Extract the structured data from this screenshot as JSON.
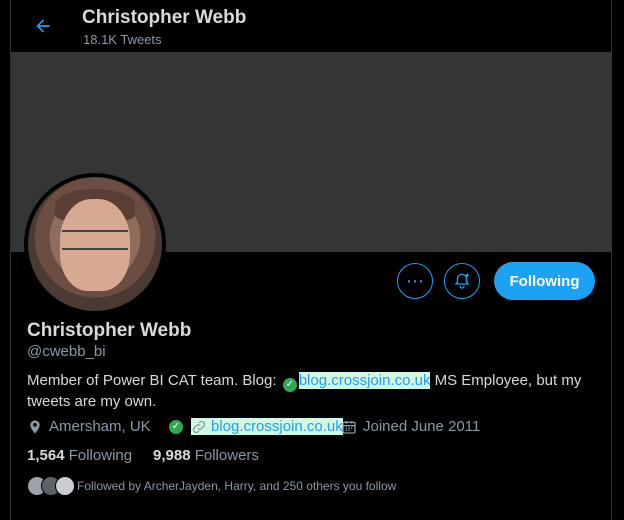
{
  "header": {
    "title": "Christopher Webb",
    "tweets_count": "18.1K Tweets"
  },
  "profile": {
    "name": "Christopher Webb",
    "handle": "@cwebb_bi",
    "bio_prefix": "Member of Power BI CAT team. Blog: ",
    "bio_link": "blog.crossjoin.co.uk",
    "bio_suffix": " MS Employee, but my tweets are my own.",
    "location": "Amersham, UK",
    "website": "blog.crossjoin.co.uk",
    "joined": "Joined June 2011",
    "following_count": "1,564",
    "following_label": "Following",
    "followers_count": "9,988",
    "followers_label": "Followers",
    "followed_by": "Followed by ArcherJayden, Harry, and 250 others you follow"
  },
  "buttons": {
    "follow_label": "Following"
  },
  "colors": {
    "accent": "#1da1f2",
    "banner": "#333537",
    "background": "#000000"
  }
}
